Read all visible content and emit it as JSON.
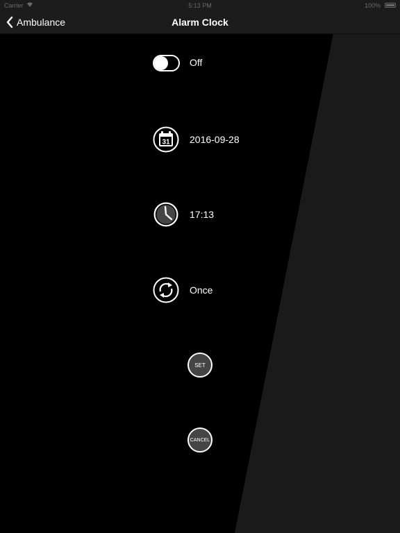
{
  "status_bar": {
    "carrier": "Carrier",
    "time": "5:13 PM",
    "battery": "100%"
  },
  "nav": {
    "back_label": "Ambulance",
    "title": "Alarm Clock"
  },
  "alarm": {
    "enabled_label": "Off",
    "enabled": false,
    "date": "2016-09-28",
    "calendar_day": "31",
    "time": "17:13",
    "repeat": "Once"
  },
  "actions": {
    "set_label": "SET",
    "cancel_label": "CANCEL"
  },
  "colors": {
    "background": "#000000",
    "bar": "#1c1c1c",
    "wedge": "#1a1a1a",
    "button_fill": "#454545",
    "foreground": "#ffffff"
  },
  "icons": {
    "back": "chevron-left-icon",
    "date": "calendar-icon",
    "time": "clock-icon",
    "repeat": "repeat-icon"
  }
}
